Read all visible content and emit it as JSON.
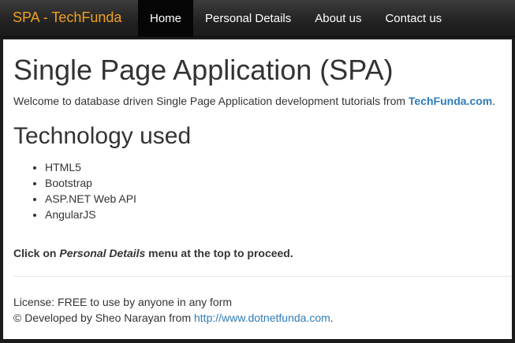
{
  "navbar": {
    "brand": "SPA - TechFunda",
    "items": [
      {
        "label": "Home",
        "active": true
      },
      {
        "label": "Personal Details",
        "active": false
      },
      {
        "label": "About us",
        "active": false
      },
      {
        "label": "Contact us",
        "active": false
      }
    ]
  },
  "main": {
    "title": "Single Page Application (SPA)",
    "lead_text": "Welcome to database driven Single Page Application development tutorials from ",
    "lead_link": "TechFunda.com",
    "lead_end": ".",
    "tech_heading": "Technology used",
    "technologies": [
      "HTML5",
      "Bootstrap",
      "ASP.NET Web API",
      "AngularJS"
    ],
    "proceed_before": "Click on ",
    "proceed_em": "Personal Details",
    "proceed_after": " menu at the top to proceed."
  },
  "footer": {
    "license": "License: FREE to use by anyone in any form",
    "developed_by": "© Developed by Sheo Narayan from ",
    "link": "http://www.dotnetfunda.com",
    "end": "."
  },
  "colors": {
    "brand": "#f0a020",
    "link": "#2f7bb8",
    "navbar_bg": "#222222"
  }
}
